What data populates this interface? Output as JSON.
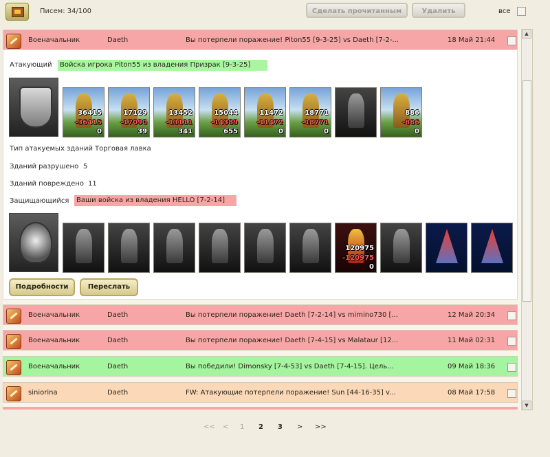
{
  "topbar": {
    "letters_count": "Писем: 34/100",
    "mark_read_label": "Сделать прочитанным",
    "delete_label": "Удалить",
    "all_label": "все"
  },
  "messages": [
    {
      "sender": "Военачальник",
      "to": "Daeth",
      "subject": "Вы потерпели поражение! Piton55 [9-3-25] vs Daeth [7-2-...",
      "date": "18 Май 21:44",
      "color": "#f6a6a6"
    },
    {
      "sender": "Военачальник",
      "to": "Daeth",
      "subject": "Вы потерпели поражение! Daeth [7-2-14] vs mimino730 [...",
      "date": "12 Май 20:34",
      "color": "#f6a6a6"
    },
    {
      "sender": "Военачальник",
      "to": "Daeth",
      "subject": "Вы потерпели поражение! Daeth [7-4-15] vs Malataur [12...",
      "date": "11 Май 02:31",
      "color": "#f6a6a6"
    },
    {
      "sender": "Военачальник",
      "to": "Daeth",
      "subject": "Вы победили! Dimonsky [7-4-53] vs Daeth [7-4-15]. Цель...",
      "date": "09 Май 18:36",
      "color": "#a4f4a0"
    },
    {
      "sender": "siniorina",
      "to": "Daeth",
      "subject": "FW: Атакующие потерпели поражение! Sun [44-16-35] v...",
      "date": "08 Май 17:58",
      "color": "#fad8b8"
    }
  ],
  "detail": {
    "attacker_label": "Атакующий",
    "attacker_value": "Войска игрока Piton55 из владения Призрак [9-3-25]",
    "attacker_units": [
      {
        "n1": "36415",
        "n2": "-36415",
        "n3": "0"
      },
      {
        "n1": "17129",
        "n2": "-17090",
        "n3": "39"
      },
      {
        "n1": "13452",
        "n2": "-13111",
        "n3": "341"
      },
      {
        "n1": "15044",
        "n2": "-14389",
        "n3": "655"
      },
      {
        "n1": "11472",
        "n2": "-11472",
        "n3": "0"
      },
      {
        "n1": "18771",
        "n2": "-18771",
        "n3": "0"
      },
      {
        "n1": "",
        "n2": "",
        "n3": ""
      },
      {
        "n1": "886",
        "n2": "-886",
        "n3": "0"
      }
    ],
    "building_type_label": "Тип атакуемых зданий",
    "building_type_value": "Торговая лавка",
    "destroyed_label": "Зданий разрушено",
    "destroyed_value": "5",
    "damaged_label": "Зданий повреждено",
    "damaged_value": "11",
    "defender_label": "Защищающийся",
    "defender_value": "Ваши войска из владения HELLO [7-2-14]",
    "defender_units": [
      {
        "n1": "",
        "n2": "",
        "n3": ""
      },
      {
        "n1": "",
        "n2": "",
        "n3": ""
      },
      {
        "n1": "",
        "n2": "",
        "n3": ""
      },
      {
        "n1": "",
        "n2": "",
        "n3": ""
      },
      {
        "n1": "",
        "n2": "",
        "n3": ""
      },
      {
        "n1": "",
        "n2": "",
        "n3": ""
      },
      {
        "n1": "120975",
        "n2": "-120975",
        "n3": "0"
      },
      {
        "n1": "",
        "n2": "",
        "n3": ""
      },
      {
        "n1": "",
        "n2": "",
        "n3": ""
      },
      {
        "n1": "",
        "n2": "",
        "n3": ""
      }
    ],
    "details_button": "Подробности",
    "forward_button": "Переслать"
  },
  "pagination": {
    "first": "<<",
    "prev": "<",
    "p1": "1",
    "p2": "2",
    "p3": "3",
    "next": ">",
    "last": ">>"
  }
}
